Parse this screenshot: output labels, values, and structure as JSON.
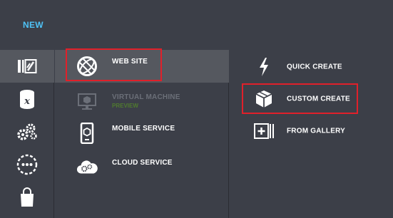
{
  "header": {
    "title": "NEW"
  },
  "rail": {
    "items": [
      {
        "icon": "web-apps-icon",
        "selected": true
      },
      {
        "icon": "database-x-icon",
        "selected": false
      },
      {
        "icon": "gears-icon",
        "selected": false
      },
      {
        "icon": "more-dots-icon",
        "selected": false
      },
      {
        "icon": "store-bag-icon",
        "selected": false
      }
    ]
  },
  "services": [
    {
      "label": "WEB SITE",
      "icon": "globe-icon",
      "selected": true
    },
    {
      "label": "VIRTUAL MACHINE",
      "sublabel": "PREVIEW",
      "icon": "monitor-icon",
      "disabled": true
    },
    {
      "label": "MOBILE SERVICE",
      "icon": "phone-icon"
    },
    {
      "label": "CLOUD SERVICE",
      "icon": "cloud-gears-icon"
    }
  ],
  "options": [
    {
      "label": "QUICK CREATE",
      "icon": "lightning-icon"
    },
    {
      "label": "CUSTOM CREATE",
      "icon": "box-icon",
      "highlighted": true
    },
    {
      "label": "FROM GALLERY",
      "icon": "gallery-plus-icon"
    }
  ],
  "colors": {
    "accent": "#4fc3f7",
    "background": "#3c3f48",
    "selected": "#55585f",
    "highlight": "#e0202a",
    "preview": "#4f7a2e"
  }
}
